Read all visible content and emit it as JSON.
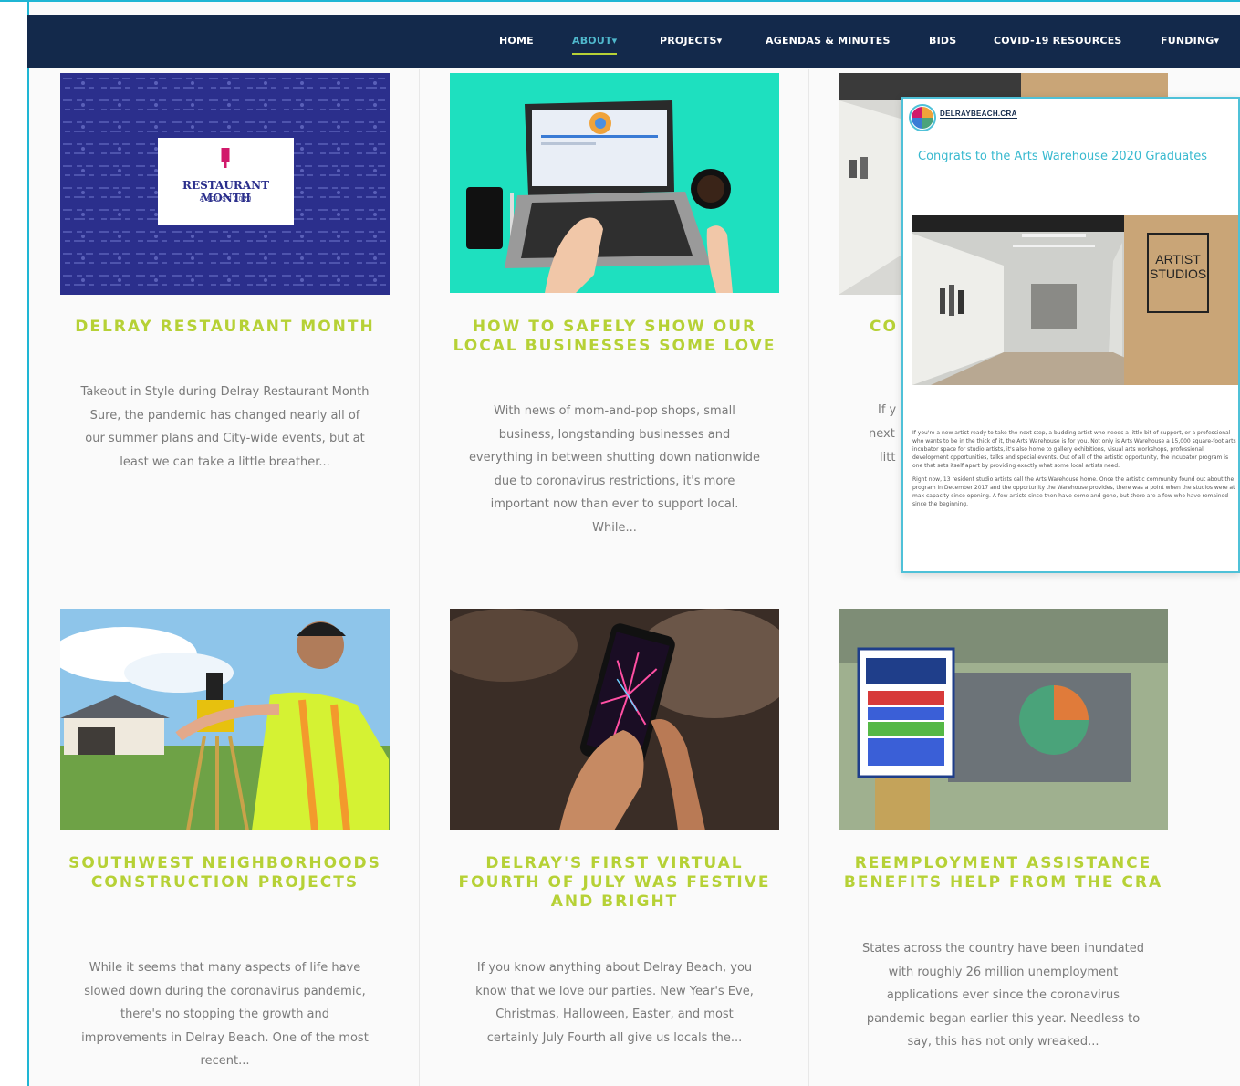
{
  "nav": {
    "items": [
      {
        "label": "HOME"
      },
      {
        "label": "ABOUT▾"
      },
      {
        "label": "PROJECTS▾"
      },
      {
        "label": "AGENDAS & MINUTES"
      },
      {
        "label": "BIDS"
      },
      {
        "label": "COVID-19 RESOURCES"
      },
      {
        "label": "FUNDING▾"
      }
    ],
    "active_item": "ABOUT▾"
  },
  "cards": [
    {
      "title": "DELRAY RESTAURANT MONTH",
      "excerpt": "Takeout in Style during Delray Restaurant Month Sure, the pandemic has changed nearly all of our summer plans and City-wide events, but at least we can take a little breather...",
      "image_label": "RESTAURANT MONTH",
      "image_sublabel": "AUGUST 2020"
    },
    {
      "title": "HOW TO SAFELY SHOW OUR LOCAL BUSINESSES SOME LOVE",
      "excerpt": "With news of mom-and-pop shops, small business, longstanding businesses and everything in between shutting down nationwide due to coronavirus restrictions, it's more important now than ever to support local. While..."
    },
    {
      "title_fragment": "CO",
      "excerpt_fragments": [
        "If y",
        "next",
        "litt"
      ]
    },
    {
      "title": "SOUTHWEST NEIGHBORHOODS CONSTRUCTION PROJECTS",
      "excerpt": "While it seems that many aspects of life have slowed down during the coronavirus pandemic, there's no stopping the growth and improvements in Delray Beach. One of the most recent..."
    },
    {
      "title": "DELRAY'S FIRST VIRTUAL FOURTH OF JULY WAS FESTIVE AND BRIGHT",
      "excerpt": "If you know anything about Delray Beach, you know that we love our parties. New Year's Eve, Christmas, Halloween, Easter, and most certainly July Fourth all give us locals the..."
    },
    {
      "title": "REEMPLOYMENT ASSISTANCE BENEFITS HELP FROM THE CRA",
      "excerpt": "States across the country have been inundated with roughly 26 million unemployment applications ever since the coronavirus pandemic began earlier this year. Needless to say, this has not only wreaked..."
    }
  ],
  "popup": {
    "logo_text": "DELRAYBEACH.CRA",
    "title": "Congrats to the Arts Warehouse 2020 Graduates",
    "sign_text_1": "ARTIST",
    "sign_text_2": "STUDIOS",
    "paragraph_1": "If you're a new artist ready to take the next step, a budding artist who needs a little bit of support, or a professional who wants to be in the thick of it, the Arts Warehouse is for you. Not only is Arts Warehouse a 15,000 square-foot arts incubator space for studio artists, it's also home to gallery exhibitions, visual arts workshops, professional development opportunities, talks and special events. Out of all of the artistic opportunity, the incubator program is one that sets itself apart by providing exactly what some local artists need.",
    "paragraph_2": "Right now, 13 resident studio artists call the Arts Warehouse home. Once the artistic community found out about the program in December 2017 and the opportunity the Warehouse provides, there was a point when the studios were at max capacity since opening. A few artists since then have come and gone, but there are a few who have remained since the beginning."
  },
  "colors": {
    "nav_bg": "#13294b",
    "accent_cyan": "#1fb6d4",
    "title_green": "#b6d136",
    "active_nav": "#4fb8cc"
  }
}
